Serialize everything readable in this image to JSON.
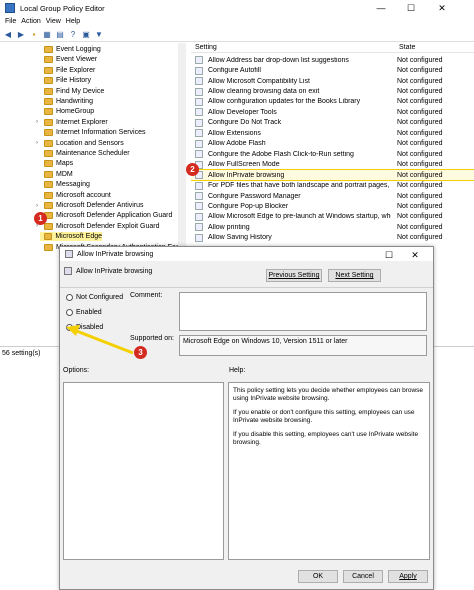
{
  "window": {
    "title": "Local Group Policy Editor",
    "min": "—",
    "max": "☐",
    "close": "✕"
  },
  "menu": [
    "File",
    "Action",
    "View",
    "Help"
  ],
  "tree_items": [
    {
      "label": "Event Logging",
      "expander": ""
    },
    {
      "label": "Event Viewer",
      "expander": ""
    },
    {
      "label": "File Explorer",
      "expander": ""
    },
    {
      "label": "File History",
      "expander": ""
    },
    {
      "label": "Find My Device",
      "expander": ""
    },
    {
      "label": "Handwriting",
      "expander": ""
    },
    {
      "label": "HomeGroup",
      "expander": ""
    },
    {
      "label": "Internet Explorer",
      "expander": "›"
    },
    {
      "label": "Internet Information Services",
      "expander": ""
    },
    {
      "label": "Location and Sensors",
      "expander": "›"
    },
    {
      "label": "Maintenance Scheduler",
      "expander": ""
    },
    {
      "label": "Maps",
      "expander": ""
    },
    {
      "label": "MDM",
      "expander": ""
    },
    {
      "label": "Messaging",
      "expander": ""
    },
    {
      "label": "Microsoft account",
      "expander": ""
    },
    {
      "label": "Microsoft Defender Antivirus",
      "expander": "›"
    },
    {
      "label": "Microsoft Defender Application Guard",
      "expander": ""
    },
    {
      "label": "Microsoft Defender Exploit Guard",
      "expander": "›"
    },
    {
      "label": "Microsoft Edge",
      "expander": ""
    },
    {
      "label": "Microsoft Secondary Authentication Factor",
      "expander": ""
    }
  ],
  "list": {
    "col_setting": "Setting",
    "col_state": "State",
    "rows": [
      {
        "name": "Allow Address bar drop-down list suggestions",
        "state": "Not configured"
      },
      {
        "name": "Configure Autofill",
        "state": "Not configured"
      },
      {
        "name": "Allow Microsoft Compatibility List",
        "state": "Not configured"
      },
      {
        "name": "Allow clearing browsing data on exit",
        "state": "Not configured"
      },
      {
        "name": "Allow configuration updates for the Books Library",
        "state": "Not configured"
      },
      {
        "name": "Allow Developer Tools",
        "state": "Not configured"
      },
      {
        "name": "Configure Do Not Track",
        "state": "Not configured"
      },
      {
        "name": "Allow Extensions",
        "state": "Not configured"
      },
      {
        "name": "Allow Adobe Flash",
        "state": "Not configured"
      },
      {
        "name": "Configure the Adobe Flash Click-to-Run setting",
        "state": "Not configured"
      },
      {
        "name": "Allow FullScreen Mode",
        "state": "Not configured"
      },
      {
        "name": "Allow InPrivate browsing",
        "state": "Not configured"
      },
      {
        "name": "For PDF files that have both landscape and portrait pages, pr...",
        "state": "Not configured"
      },
      {
        "name": "Configure Password Manager",
        "state": "Not configured"
      },
      {
        "name": "Configure Pop-up Blocker",
        "state": "Not configured"
      },
      {
        "name": "Allow Microsoft Edge to pre-launch at Windows startup, whe...",
        "state": "Not configured"
      },
      {
        "name": "Allow printing",
        "state": "Not configured"
      },
      {
        "name": "Allow Saving History",
        "state": "Not configured"
      }
    ]
  },
  "status": "56 setting(s)",
  "dialog": {
    "title": "Allow InPrivate browsing",
    "setting_name": "Allow InPrivate browsing",
    "prev_btn": "Previous Setting",
    "next_btn": "Next Setting",
    "radio_not_configured": "Not Configured",
    "radio_enabled": "Enabled",
    "radio_disabled": "Disabled",
    "comment_label": "Comment:",
    "supported_label": "Supported on:",
    "supported_value": "Microsoft Edge on Windows 10, Version 1511 or later",
    "options_label": "Options:",
    "help_label": "Help:",
    "help_p1": "This policy setting lets you decide whether employees can browse using InPrivate website browsing.",
    "help_p2": "If you enable or don't configure this setting, employees can use InPrivate website browsing.",
    "help_p3": "If you disable this setting, employees can't use InPrivate website browsing.",
    "ok_btn": "OK",
    "cancel_btn": "Cancel",
    "apply_btn": "Apply"
  },
  "badges": [
    "1",
    "2",
    "3"
  ],
  "colors": {
    "highlight": "#fff29a",
    "badge": "#d42a1f",
    "arrow": "#f5d000"
  }
}
